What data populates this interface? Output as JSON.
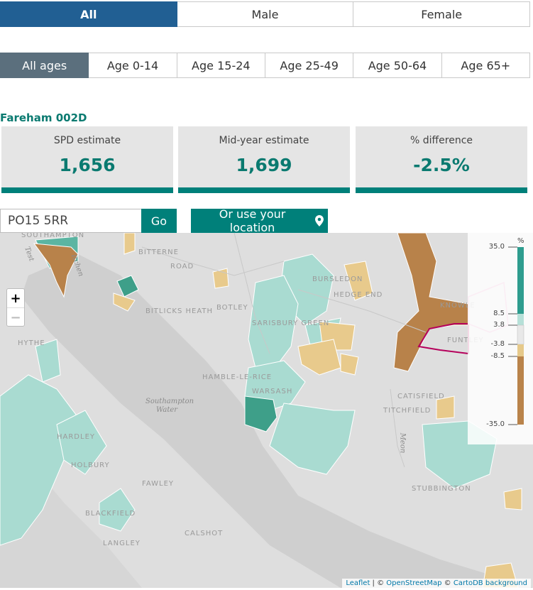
{
  "sex_tabs": [
    {
      "label": "All",
      "active": true
    },
    {
      "label": "Male",
      "active": false
    },
    {
      "label": "Female",
      "active": false
    }
  ],
  "age_tabs": [
    {
      "label": "All ages",
      "active": true
    },
    {
      "label": "Age 0-14",
      "active": false
    },
    {
      "label": "Age 15-24",
      "active": false
    },
    {
      "label": "Age 25-49",
      "active": false
    },
    {
      "label": "Age 50-64",
      "active": false
    },
    {
      "label": "Age 65+",
      "active": false
    }
  ],
  "area": {
    "name": "Fareham 002D"
  },
  "stats": [
    {
      "label": "SPD estimate",
      "value": "1,656"
    },
    {
      "label": "Mid-year estimate",
      "value": "1,699"
    },
    {
      "label": "% difference",
      "value": "-2.5%"
    }
  ],
  "search": {
    "value": "PO15 5RR",
    "go_label": "Go",
    "location_label": "Or use your location",
    "location_icon": "map-pin-icon"
  },
  "map": {
    "zoom_in": "+",
    "zoom_out": "−",
    "place_labels": {
      "southampton": "SOUTHAMPTON",
      "bitterne": "BITTERNE",
      "bursledon": "BURSLEDON",
      "hedge_end": "HEDGE END",
      "botley": "BOTLEY",
      "bitlicks": "BITLICKS HEATH",
      "hythe": "HYTHE",
      "hamble": "HAMBLE-LE-RICE",
      "sarisbury": "SARISBURY GREEN",
      "titchfield": "TITCHFIELD",
      "catisfield": "CATISFIELD",
      "warsash": "WARSASH",
      "holbury": "HOLBURY",
      "fawley": "FAWLEY",
      "blackfield": "BLACKFIELD",
      "langley": "LANGLEY",
      "calshot": "CALSHOT",
      "stubbington": "STUBBINGTON",
      "knowle": "KNOWLE",
      "funtley": "FUNTLEY",
      "hardley": "HARDLEY",
      "eastleigh_rd": "ROAD",
      "test": "Test",
      "itchen": "Itchen",
      "meon": "Meon",
      "water": "Southampton Water"
    }
  },
  "legend": {
    "unit": "%",
    "ticks": [
      "35.0",
      "8.5",
      "3.8",
      "-3.8",
      "-8.5",
      "-35.0"
    ],
    "colors": {
      "high": "#2e9c8e",
      "mid_high": "#b6e0d8",
      "neutral": "#e8e8e8",
      "mid_low": "#e6c98a",
      "low": "#b9834a"
    }
  },
  "attribution": {
    "leaflet": "Leaflet",
    "sep1": " | © ",
    "osm": "OpenStreetMap",
    "sep2": " © ",
    "carto": "CartoDB background"
  },
  "colors": {
    "primary_blue": "#215f93",
    "teal": "#00807a",
    "age_active": "#5b6f7d"
  }
}
